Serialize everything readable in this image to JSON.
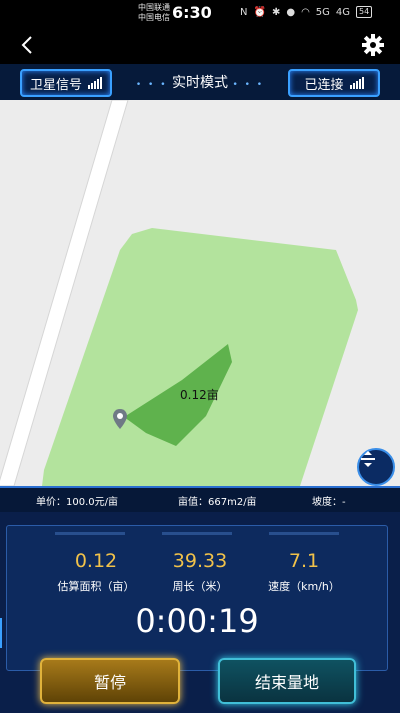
{
  "status_bar": {
    "carrier_1": "中国联通",
    "carrier_2": "中国电信",
    "time": "6:30",
    "network_1": "5G",
    "network_2": "4G",
    "battery": "54"
  },
  "mode_bar": {
    "satellite_label": "卫星信号",
    "title": "实时模式",
    "connection_label": "已连接"
  },
  "map": {
    "area_label": "0.12亩"
  },
  "info_row": {
    "unit_price": "单价：100.0元/亩",
    "mu_value": "亩值：667m2/亩",
    "slope": "坡度：-"
  },
  "stats": [
    {
      "value": "0.12",
      "label": "估算面积（亩）"
    },
    {
      "value": "39.33",
      "label": "周长（米）"
    },
    {
      "value": "7.1",
      "label": "速度（km/h）"
    }
  ],
  "timer": "0:00:19",
  "buttons": {
    "pause": "暂停",
    "end": "结束量地"
  },
  "colors": {
    "panel_bg": "#0a1f4a",
    "stat_value": "#f1c24a",
    "pause_accent": "#e0b23b",
    "end_accent": "#41bfd8",
    "field_fill": "#a9e28f",
    "measured_fill": "#5fb24d"
  },
  "icons": {
    "back": "chevron-left-icon",
    "settings": "gear-icon",
    "signal": "signal-bars-icon",
    "pin": "location-pin-icon",
    "toggle": "expand-collapse-icon"
  }
}
